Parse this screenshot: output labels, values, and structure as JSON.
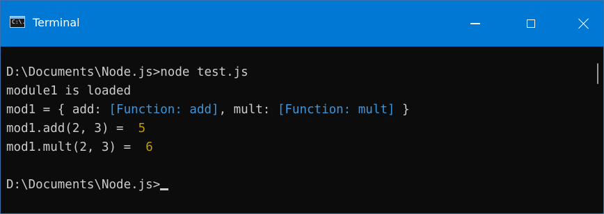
{
  "window": {
    "title": "Terminal",
    "icon_label": "C:\\."
  },
  "colors": {
    "titlebar": "#0078d4",
    "console_bg": "#0c0c0c",
    "text": "#cccccc",
    "function_text": "#3a96dd",
    "number_text": "#c19c00"
  },
  "console": {
    "lines": [
      {
        "parts": [
          {
            "text": "D:\\Documents\\Node.js>node test.js",
            "style": "plain"
          }
        ]
      },
      {
        "parts": [
          {
            "text": "module1 is loaded",
            "style": "plain"
          }
        ]
      },
      {
        "parts": [
          {
            "text": "mod1 = { add: ",
            "style": "plain"
          },
          {
            "text": "[Function: add]",
            "style": "fn"
          },
          {
            "text": ", mult: ",
            "style": "plain"
          },
          {
            "text": "[Function: mult]",
            "style": "fn"
          },
          {
            "text": " }",
            "style": "plain"
          }
        ]
      },
      {
        "parts": [
          {
            "text": "mod1.add(2, 3) =  ",
            "style": "plain"
          },
          {
            "text": "5",
            "style": "num"
          }
        ]
      },
      {
        "parts": [
          {
            "text": "mod1.mult(2, 3) =  ",
            "style": "plain"
          },
          {
            "text": "6",
            "style": "num"
          }
        ]
      },
      {
        "parts": [
          {
            "text": "",
            "style": "plain"
          }
        ]
      },
      {
        "parts": [
          {
            "text": "D:\\Documents\\Node.js>",
            "style": "plain"
          }
        ],
        "cursor": true
      }
    ]
  },
  "icons": {
    "app": "terminal-app-icon",
    "minimize": "minimize-icon",
    "maximize": "maximize-icon",
    "close": "close-icon"
  }
}
